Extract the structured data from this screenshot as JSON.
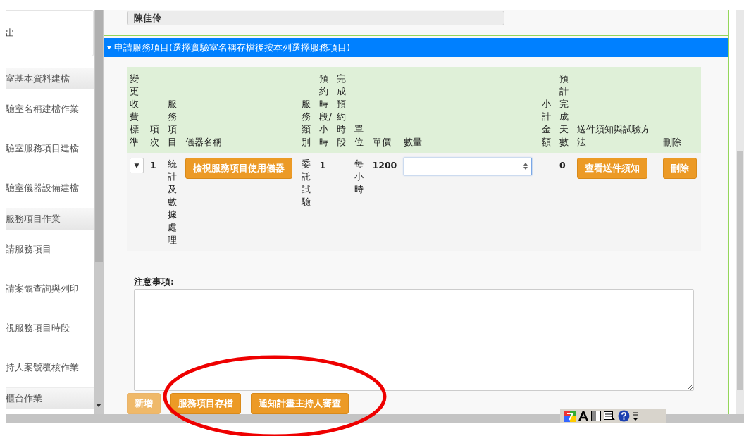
{
  "sidebar": {
    "items": [
      {
        "kind": "card",
        "label": "出"
      },
      {
        "kind": "header",
        "label": "室基本資料建檔"
      },
      {
        "kind": "item",
        "label": "驗室名稱建檔作業"
      },
      {
        "kind": "item",
        "label": "驗室服務項目建檔"
      },
      {
        "kind": "item",
        "label": "驗室儀器設備建檔"
      },
      {
        "kind": "header",
        "label": "服務項目作業"
      },
      {
        "kind": "item",
        "label": "請服務項目"
      },
      {
        "kind": "item",
        "label": "請案號查詢與列印"
      },
      {
        "kind": "item",
        "label": "視服務項目時段"
      },
      {
        "kind": "item",
        "label": "持人案號覆核作業"
      },
      {
        "kind": "header",
        "label": "櫃台作業"
      }
    ]
  },
  "applicant": {
    "value": "陳佳伶"
  },
  "section": {
    "title": "申請服務項目(選擇實驗室名稱存檔後按本列選擇服務項目)",
    "expanded": true
  },
  "table": {
    "columns": [
      {
        "label": "變更收費標準",
        "vertical": true
      },
      {
        "label": "項次",
        "vertical": true
      },
      {
        "label": "服務項目",
        "vertical": true
      },
      {
        "label": "儀器名稱",
        "vertical": false
      },
      {
        "label": "服務類別",
        "vertical": true
      },
      {
        "label": "預約時段/小時",
        "vertical": true
      },
      {
        "label": "完成預約時段",
        "vertical": true
      },
      {
        "label": "單位",
        "vertical": true
      },
      {
        "label": "單價",
        "vertical": false
      },
      {
        "label": "數量",
        "vertical": false
      },
      {
        "label": "小計金額",
        "vertical": true
      },
      {
        "label": "預計完成天數",
        "vertical": true
      },
      {
        "label": "送件須知與試驗方法",
        "vertical": false
      },
      {
        "label": "刪除",
        "vertical": false
      }
    ],
    "rows": [
      {
        "cells": [
          {
            "kind": "dropdown",
            "text": "▼"
          },
          {
            "kind": "bold",
            "text": "1"
          },
          {
            "kind": "vertical",
            "text": "統計及數據處理"
          },
          {
            "kind": "button",
            "text": "檢視服務項目使用儀器"
          },
          {
            "kind": "vertical",
            "text": "委託試驗"
          },
          {
            "kind": "bold",
            "text": "1"
          },
          {
            "kind": "empty"
          },
          {
            "kind": "vertical",
            "text": "每小時"
          },
          {
            "kind": "bold",
            "text": "1200"
          },
          {
            "kind": "number"
          },
          {
            "kind": "empty"
          },
          {
            "kind": "bold",
            "text": "0"
          },
          {
            "kind": "button",
            "text": "查看送件須知"
          },
          {
            "kind": "button",
            "text": "刪除"
          }
        ]
      }
    ]
  },
  "notes": {
    "label": "注意事項:"
  },
  "buttons": [
    {
      "label": "新增",
      "disabled": true
    },
    {
      "label": "服務項目存檔",
      "disabled": false
    },
    {
      "label": "通知計畫主持人審查",
      "disabled": false
    }
  ]
}
